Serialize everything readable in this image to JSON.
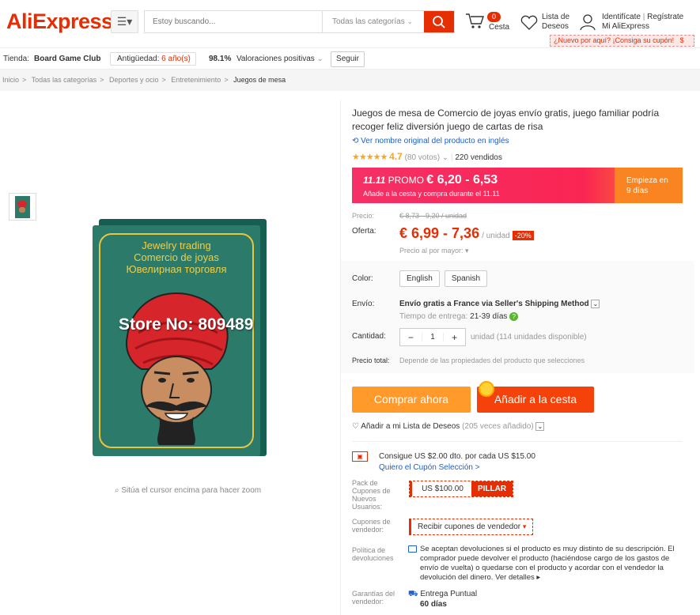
{
  "header": {
    "logo": "AliExpress",
    "search_placeholder": "Estoy buscando...",
    "search_category": "Todas las categorías",
    "cart_count": "0",
    "cart_label": "Cesta",
    "wishlist_line1": "Lista de",
    "wishlist_line2": "Deseos",
    "signin": "Identifícate",
    "register": "Regístrate",
    "my_account": "Mi AliExpress",
    "coupon_tip": "¿Nuevo por aquí? ¡Consiga su cupón!",
    "coupon_tip_amount": "$"
  },
  "store": {
    "label": "Tienda:",
    "name": "Board Game Club",
    "age_label": "Antigüedad:",
    "age_value": "6 año(s)",
    "positive_pct": "98.1%",
    "positive_label": "Valoraciones positivas",
    "follow": "Seguir"
  },
  "breadcrumb": [
    "Inicio",
    "Todas las categorías",
    "Deportes y ocio",
    "Entretenimiento",
    "Juegos de mesa"
  ],
  "gallery": {
    "card_line1": "Jewelry trading",
    "card_line2": "Comercio de joyas",
    "card_line3": "Ювелирная торговля",
    "watermark": "Store No: 809489",
    "zoom_hint": "Sitúa el cursor encima para hacer zoom"
  },
  "product": {
    "title": "Juegos de mesa de Comercio de joyas envío gratis, juego familiar podría recoger feliz diversión juego de cartas de risa",
    "translate_link": "Ver nombre original del producto en inglés",
    "rating": "4.7",
    "votes": "(80 votos)",
    "sold": "220 vendidos",
    "promo_tag": "11.11",
    "promo_word": "PROMO",
    "promo_price": "€ 6,20 - 6,53",
    "promo_sub": "Añade a la cesta y compra durante el 11.11",
    "promo_start_line1": "Empieza en",
    "promo_start_line2": "9 días",
    "price_label": "Precio:",
    "price_old": "€ 8,73 - 9,20 / unidad",
    "offer_label": "Oferta:",
    "offer_price": "€ 6,99 - 7,36",
    "offer_unit": "/ unidad",
    "discount": "-20%",
    "wholesale": "Precio al por mayor:",
    "color_label": "Color:",
    "color_options": [
      "English",
      "Spanish"
    ],
    "shipping_label": "Envío:",
    "shipping_value": "Envío gratis a France via Seller's Shipping Method",
    "delivery_label": "Tiempo de entrega:",
    "delivery_value": "21-39 días",
    "qty_label": "Cantidad:",
    "qty_value": "1",
    "qty_available": "unidad (114 unidades disponible)",
    "total_label": "Precio total:",
    "total_value": "Depende de las propiedades del producto que selecciones",
    "buy_now": "Comprar ahora",
    "add_to_cart": "Añadir a la cesta",
    "wishlist": "Añadir a mi Lista de Deseos",
    "wishlist_count": "(205 veces añadido)",
    "coupon_text": "Consigue US $2.00 dto. por cada US $15.00",
    "coupon_link": "Quiero el Cupón Selección >",
    "newuser_label": "Pack de Cupones de Nuevos Usuarios:",
    "newuser_amount": "US $100.00",
    "newuser_action": "PILLAR",
    "vendor_label": "Cupones de vendedor:",
    "vendor_value": "Recibir cupones de vendedor",
    "returns_label": "Política de devoluciones",
    "returns_text": "Se aceptan devoluciones si el producto es muy distinto de su descripción. El comprador puede devolver el producto (haciéndose cargo de los gastos de envío de vuelta) o quedarse con el producto y acordar con el vendedor la devolución del dinero.",
    "returns_more": "Ver detalles",
    "guarantee_label": "Garantías del vendedor:",
    "guarantee_value": "Entrega Puntual",
    "guarantee_days": "60 días"
  },
  "colors": {
    "brand": "#e62e04",
    "buy": "#ff9a2b",
    "cart": "#f5420b",
    "link": "#1e5fc8"
  }
}
